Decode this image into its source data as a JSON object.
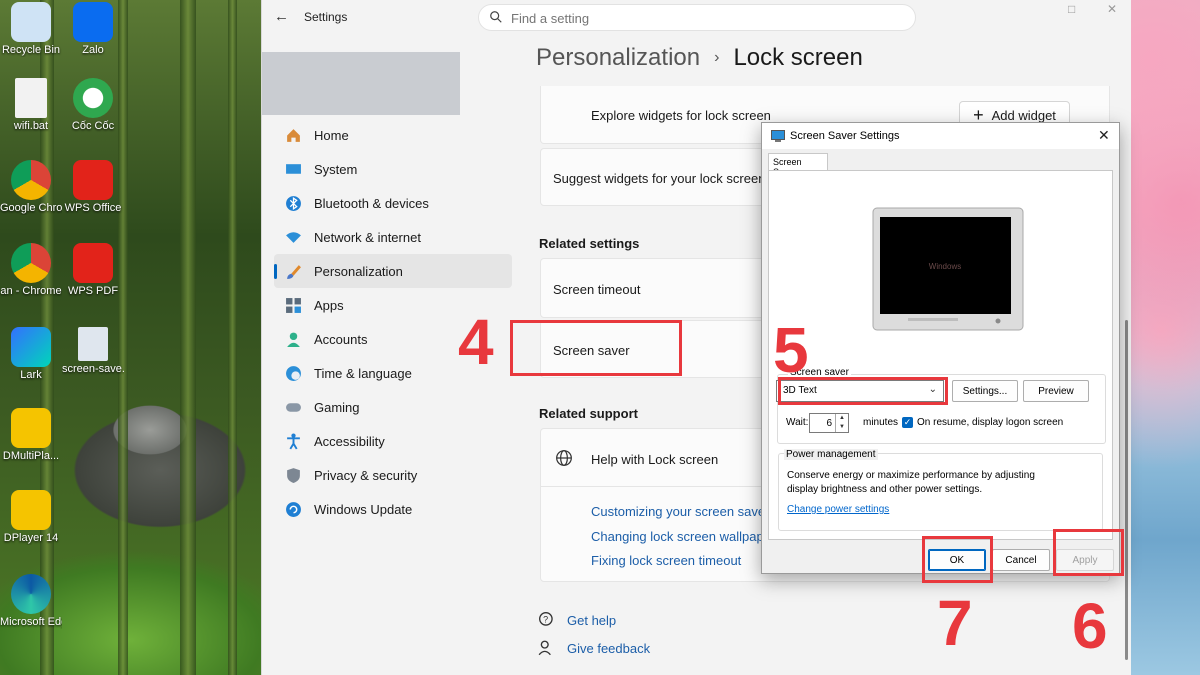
{
  "desktop": {
    "icons": [
      {
        "label": "Recycle Bin"
      },
      {
        "label": "Zalo"
      },
      {
        "label": "wifi.bat"
      },
      {
        "label": "Cốc Cốc"
      },
      {
        "label": "Google Chrome"
      },
      {
        "label": "WPS Office"
      },
      {
        "label": "an - Chrome"
      },
      {
        "label": "WPS PDF"
      },
      {
        "label": "Lark"
      },
      {
        "label": "screen-save..."
      },
      {
        "label": "DMultiPla..."
      },
      {
        "label": "DPlayer 14"
      },
      {
        "label": "Microsoft Edge"
      }
    ]
  },
  "settings": {
    "app_title": "Settings",
    "search_placeholder": "Find a setting",
    "breadcrumb": {
      "parent": "Personalization",
      "current": "Lock screen"
    },
    "nav": [
      {
        "label": "Home",
        "icon": "home-icon"
      },
      {
        "label": "System",
        "icon": "monitor-icon"
      },
      {
        "label": "Bluetooth & devices",
        "icon": "bluetooth-icon"
      },
      {
        "label": "Network & internet",
        "icon": "wifi-icon"
      },
      {
        "label": "Personalization",
        "icon": "brush-icon",
        "active": true
      },
      {
        "label": "Apps",
        "icon": "apps-icon"
      },
      {
        "label": "Accounts",
        "icon": "person-icon"
      },
      {
        "label": "Time & language",
        "icon": "globe-clock-icon"
      },
      {
        "label": "Gaming",
        "icon": "gamepad-icon"
      },
      {
        "label": "Accessibility",
        "icon": "accessibility-icon"
      },
      {
        "label": "Privacy & security",
        "icon": "shield-icon"
      },
      {
        "label": "Windows Update",
        "icon": "update-icon"
      }
    ],
    "content": {
      "explore_widgets": "Explore widgets for lock screen",
      "add_widget": "Add widget",
      "suggest_widgets": "Suggest widgets for your lock screen",
      "related_settings_heading": "Related settings",
      "screen_timeout": "Screen timeout",
      "screen_saver": "Screen saver",
      "related_support_heading": "Related support",
      "help_heading": "Help with Lock screen",
      "help_links": [
        "Customizing your screen saver se",
        "Changing lock screen wallpaper",
        "Fixing lock screen timeout"
      ],
      "get_help": "Get help",
      "give_feedback": "Give feedback"
    }
  },
  "dialog": {
    "title": "Screen Saver Settings",
    "tab": "Screen Saver",
    "preview_text": "Windows",
    "screen_saver_group": "Screen saver",
    "selected_saver": "3D Text",
    "settings_button": "Settings...",
    "preview_button": "Preview",
    "wait_label": "Wait:",
    "wait_value": "6",
    "minutes_label": "minutes",
    "resume_label": "On resume, display logon screen",
    "resume_checked": true,
    "power_group": "Power management",
    "power_text_1": "Conserve energy or maximize performance by adjusting",
    "power_text_2": "display brightness and other power settings.",
    "power_link": "Change power settings",
    "ok": "OK",
    "cancel": "Cancel",
    "apply": "Apply"
  },
  "annotations": {
    "step4": "4",
    "step5": "5",
    "step6": "6",
    "step7": "7",
    "color": "#e8383d"
  }
}
